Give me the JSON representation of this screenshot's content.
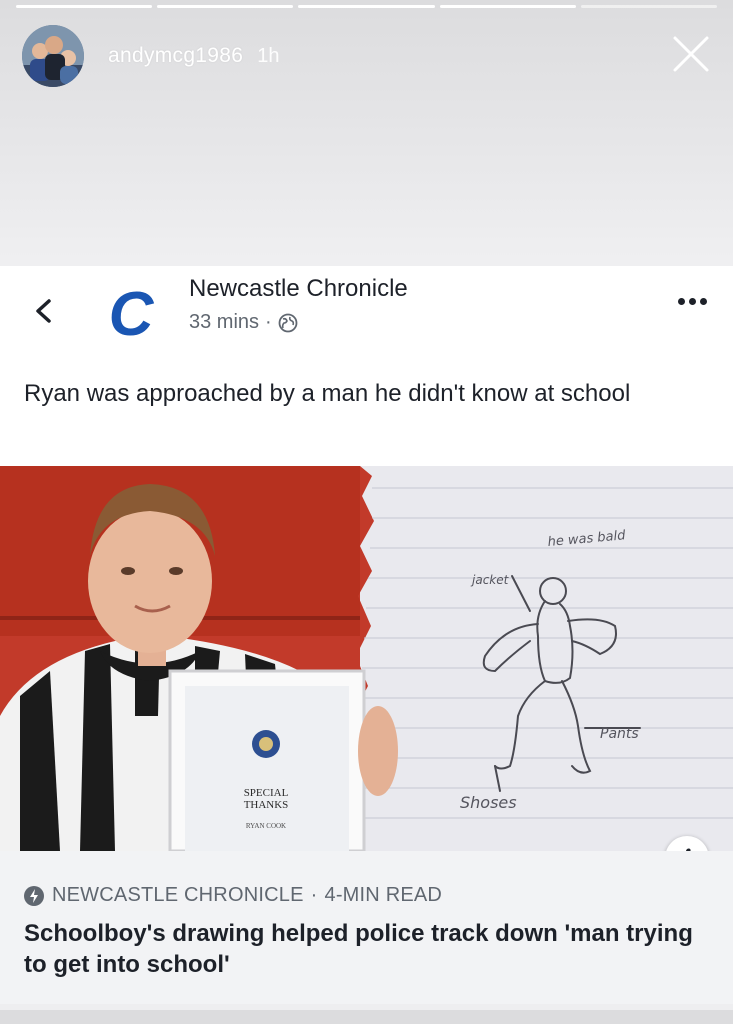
{
  "story": {
    "username": "andymcg1986",
    "time": "1h",
    "segments": [
      true,
      true,
      true,
      true,
      false
    ]
  },
  "post": {
    "page_name": "Newcastle Chronicle",
    "logo_letter": "C",
    "time": "33 mins",
    "separator": "·",
    "text": "Ryan was approached by a man he didn't know at school"
  },
  "photo": {
    "certificate_title_1": "SPECIAL",
    "certificate_title_2": "THANKS",
    "certificate_name": "RYAN COOK",
    "drawing_labels": [
      "he was bald",
      "jacket",
      "Pants",
      "Shoses"
    ]
  },
  "link": {
    "source": "NEWCASTLE CHRONICLE",
    "separator": "·",
    "read_time": "4-MIN READ",
    "headline": "Schoolboy's drawing helped police track down 'man trying to get into school'",
    "info_label": "i"
  },
  "colors": {
    "brand_blue": "#1a56b3",
    "text_primary": "#1d2129",
    "text_secondary": "#606770",
    "link_bg": "#f2f3f5"
  }
}
